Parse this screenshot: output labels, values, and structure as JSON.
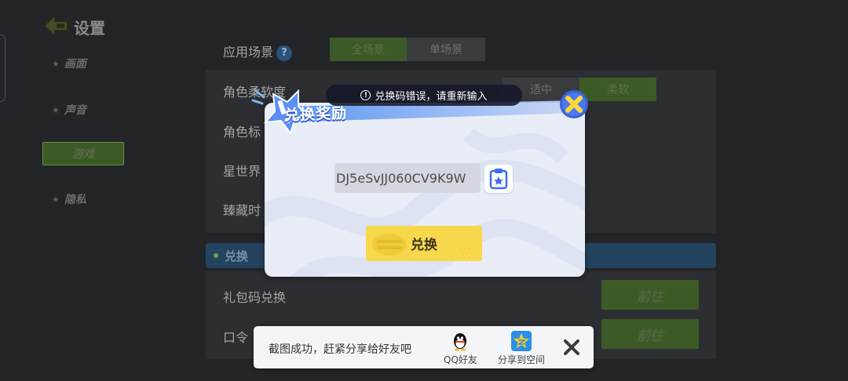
{
  "settings": {
    "title": "设置",
    "sidebar": [
      {
        "label": "画面",
        "active": false
      },
      {
        "label": "声音",
        "active": false
      },
      {
        "label": "游戏",
        "active": true
      },
      {
        "label": "隐私",
        "active": false
      }
    ],
    "rows": {
      "scene_label": "应用场景",
      "scene_options": [
        "全场景",
        "单场景"
      ],
      "scene_selected": "全场景",
      "softness_label": "角色柔软度",
      "softness_options": [
        "适中",
        "柔软"
      ],
      "role_label": "角色标",
      "star_label": "星世界",
      "hide_label": "臻藏时",
      "help_glyph": "?"
    },
    "exchange_section": {
      "title": "兑换",
      "gift_code_label": "礼包码兑换",
      "gift_code_button": "前往",
      "password_label": "口令",
      "password_button": "前往"
    }
  },
  "dialog": {
    "title": "兑换奖励",
    "error_toast": "兑换码错误，请重新输入",
    "code_value": "DJ5eSvJJ060CV9K9W",
    "redeem_button": "兑换",
    "colors": {
      "accent_blue": "#3b6ee8",
      "button_yellow": "#f7d84c",
      "close_yellow": "#ffd83a"
    }
  },
  "share_bar": {
    "message": "截图成功，赶紧分享给好友吧",
    "options": [
      {
        "label": "QQ好友",
        "icon": "qq-penguin-icon"
      },
      {
        "label": "分享到空间",
        "icon": "qzone-star-icon"
      }
    ]
  }
}
